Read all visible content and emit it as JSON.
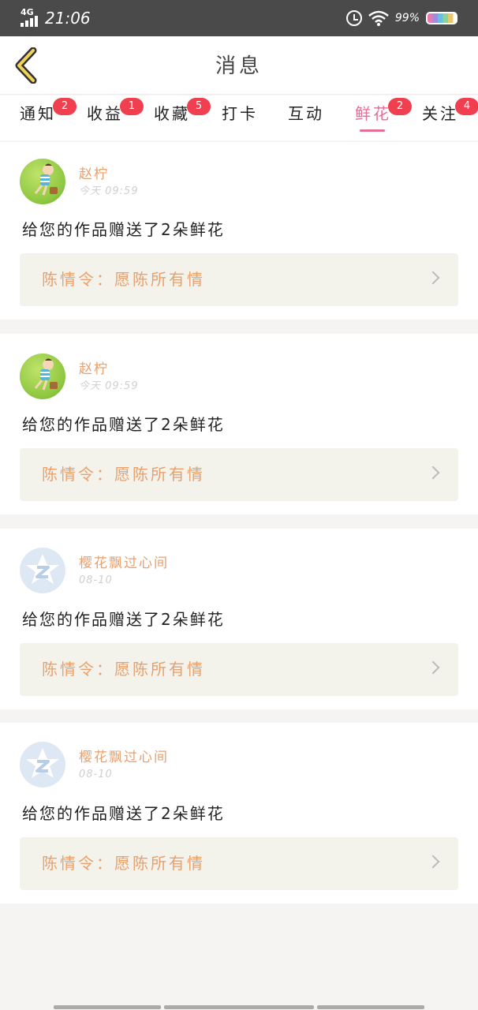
{
  "status_bar": {
    "network": "4G",
    "time": "21:06",
    "battery": "99%"
  },
  "header": {
    "title": "消息"
  },
  "tabs": [
    {
      "label": "通知",
      "badge": "2"
    },
    {
      "label": "收益",
      "badge": "1"
    },
    {
      "label": "收藏",
      "badge": "5"
    },
    {
      "label": "打卡",
      "badge": ""
    },
    {
      "label": "互动",
      "badge": ""
    },
    {
      "label": "鲜花",
      "badge": "2",
      "active": true
    },
    {
      "label": "关注",
      "badge": "4"
    }
  ],
  "messages": [
    {
      "user": "赵柠",
      "time": "今天 09:59",
      "text": "给您的作品赠送了2朵鲜花",
      "work": "陈情令：愿陈所有情",
      "avatar": "cartoon-boy-avatar"
    },
    {
      "user": "赵柠",
      "time": "今天 09:59",
      "text": "给您的作品赠送了2朵鲜花",
      "work": "陈情令：愿陈所有情",
      "avatar": "cartoon-boy-avatar"
    },
    {
      "user": "樱花飘过心间",
      "time": "08-10",
      "text": "给您的作品赠送了2朵鲜花",
      "work": "陈情令：愿陈所有情",
      "avatar": "default-z-avatar"
    },
    {
      "user": "樱花飘过心间",
      "time": "08-10",
      "text": "给您的作品赠送了2朵鲜花",
      "work": "陈情令：愿陈所有情",
      "avatar": "default-z-avatar"
    }
  ],
  "colors": {
    "accent": "#e36e98",
    "badge": "#f0404f",
    "username": "#e8a06e"
  }
}
